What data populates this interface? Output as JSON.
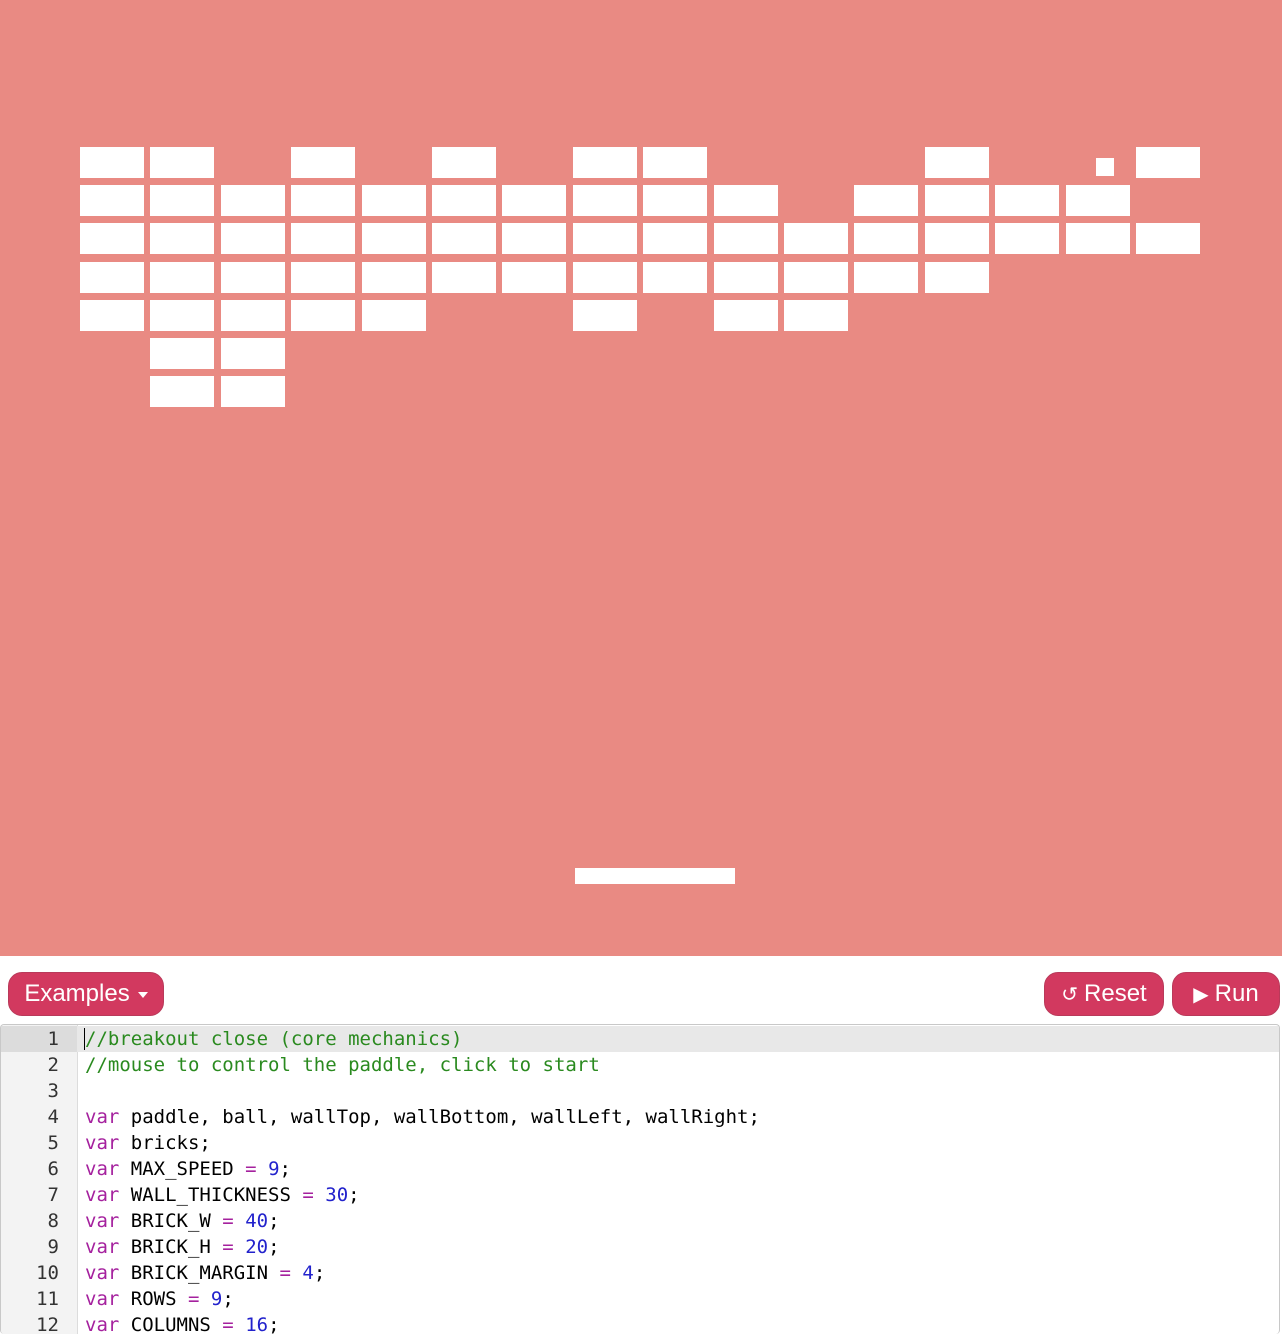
{
  "colors": {
    "canvas_bg": "#e98a83",
    "brick": "#ffffff",
    "button": "#d2395f",
    "comment": "#2a8a1f",
    "keyword": "#a5219e",
    "number": "#2222cc"
  },
  "game": {
    "bricks_remaining": [
      {
        "row": 0,
        "cols": [
          0,
          1,
          3,
          5,
          7,
          8,
          12,
          15
        ]
      },
      {
        "row": 1,
        "cols": [
          0,
          1,
          2,
          3,
          4,
          5,
          6,
          7,
          8,
          9,
          11,
          12,
          13,
          14
        ]
      },
      {
        "row": 2,
        "cols": [
          0,
          1,
          2,
          3,
          4,
          5,
          6,
          7,
          8,
          9,
          10,
          11,
          12,
          13,
          14,
          15
        ]
      },
      {
        "row": 3,
        "cols": [
          0,
          1,
          2,
          3,
          4,
          5,
          6,
          7,
          8,
          9,
          10,
          11,
          12
        ]
      },
      {
        "row": 4,
        "cols": [
          0,
          1,
          2,
          3,
          4,
          7,
          9,
          10
        ]
      },
      {
        "row": 5,
        "cols": [
          1,
          2
        ]
      },
      {
        "row": 6,
        "cols": [
          1,
          2
        ]
      }
    ]
  },
  "toolbar": {
    "examples_label": "Examples",
    "reset_icon": "↺",
    "reset_label": "Reset",
    "run_icon": "▶",
    "run_label": "Run"
  },
  "editor": {
    "active_line": 1,
    "lines": [
      {
        "n": "1",
        "tokens": [
          {
            "t": "//breakout close (core mechanics)",
            "c": "comment"
          }
        ]
      },
      {
        "n": "2",
        "tokens": [
          {
            "t": "//mouse to control the paddle, click to start",
            "c": "comment"
          }
        ]
      },
      {
        "n": "3",
        "tokens": []
      },
      {
        "n": "4",
        "tokens": [
          {
            "t": "var",
            "c": "keyword"
          },
          {
            "t": " paddle, ball, wallTop, wallBottom, wallLeft, wallRight;",
            "c": ""
          }
        ]
      },
      {
        "n": "5",
        "tokens": [
          {
            "t": "var",
            "c": "keyword"
          },
          {
            "t": " bricks;",
            "c": ""
          }
        ]
      },
      {
        "n": "6",
        "tokens": [
          {
            "t": "var",
            "c": "keyword"
          },
          {
            "t": " MAX_SPEED ",
            "c": ""
          },
          {
            "t": "=",
            "c": "op"
          },
          {
            "t": " ",
            "c": ""
          },
          {
            "t": "9",
            "c": "number"
          },
          {
            "t": ";",
            "c": ""
          }
        ]
      },
      {
        "n": "7",
        "tokens": [
          {
            "t": "var",
            "c": "keyword"
          },
          {
            "t": " WALL_THICKNESS ",
            "c": ""
          },
          {
            "t": "=",
            "c": "op"
          },
          {
            "t": " ",
            "c": ""
          },
          {
            "t": "30",
            "c": "number"
          },
          {
            "t": ";",
            "c": ""
          }
        ]
      },
      {
        "n": "8",
        "tokens": [
          {
            "t": "var",
            "c": "keyword"
          },
          {
            "t": " BRICK_W ",
            "c": ""
          },
          {
            "t": "=",
            "c": "op"
          },
          {
            "t": " ",
            "c": ""
          },
          {
            "t": "40",
            "c": "number"
          },
          {
            "t": ";",
            "c": ""
          }
        ]
      },
      {
        "n": "9",
        "tokens": [
          {
            "t": "var",
            "c": "keyword"
          },
          {
            "t": " BRICK_H ",
            "c": ""
          },
          {
            "t": "=",
            "c": "op"
          },
          {
            "t": " ",
            "c": ""
          },
          {
            "t": "20",
            "c": "number"
          },
          {
            "t": ";",
            "c": ""
          }
        ]
      },
      {
        "n": "10",
        "tokens": [
          {
            "t": "var",
            "c": "keyword"
          },
          {
            "t": " BRICK_MARGIN ",
            "c": ""
          },
          {
            "t": "=",
            "c": "op"
          },
          {
            "t": " ",
            "c": ""
          },
          {
            "t": "4",
            "c": "number"
          },
          {
            "t": ";",
            "c": ""
          }
        ]
      },
      {
        "n": "11",
        "tokens": [
          {
            "t": "var",
            "c": "keyword"
          },
          {
            "t": " ROWS ",
            "c": ""
          },
          {
            "t": "=",
            "c": "op"
          },
          {
            "t": " ",
            "c": ""
          },
          {
            "t": "9",
            "c": "number"
          },
          {
            "t": ";",
            "c": ""
          }
        ]
      },
      {
        "n": "12",
        "tokens": [
          {
            "t": "var",
            "c": "keyword"
          },
          {
            "t": " COLUMNS ",
            "c": ""
          },
          {
            "t": "=",
            "c": "op"
          },
          {
            "t": " ",
            "c": ""
          },
          {
            "t": "16",
            "c": "number"
          },
          {
            "t": ";",
            "c": ""
          }
        ]
      }
    ]
  }
}
